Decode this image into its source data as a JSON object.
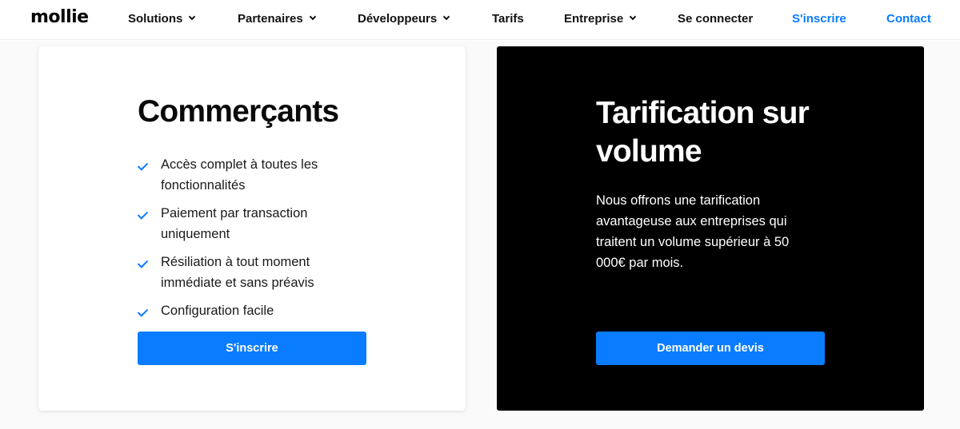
{
  "header": {
    "logo": "mollie",
    "nav": [
      {
        "label": "Solutions"
      },
      {
        "label": "Partenaires"
      },
      {
        "label": "Développeurs"
      },
      {
        "label": "Tarifs"
      },
      {
        "label": "Entreprise"
      },
      {
        "label": "Se connecter"
      },
      {
        "label": "S'inscrire"
      },
      {
        "label": "Contact"
      }
    ],
    "accent_color": "#0a7cff"
  },
  "merchants": {
    "title": "Commerçants",
    "features": [
      "Accès complet à toutes les fonctionnalités",
      "Paiement par transaction uniquement",
      "Résiliation à tout moment immédiate et sans préavis",
      "Configuration facile"
    ],
    "button_label": "S'inscrire"
  },
  "volume": {
    "title": "Tarification sur volume",
    "description": "Nous offrons une tarification avantageuse aux entreprises qui traitent un volume supérieur à 50 000€ par mois.",
    "button_label": "Demander un devis"
  },
  "icons": {
    "chevron": "chevron-down-icon",
    "check": "check-icon"
  }
}
